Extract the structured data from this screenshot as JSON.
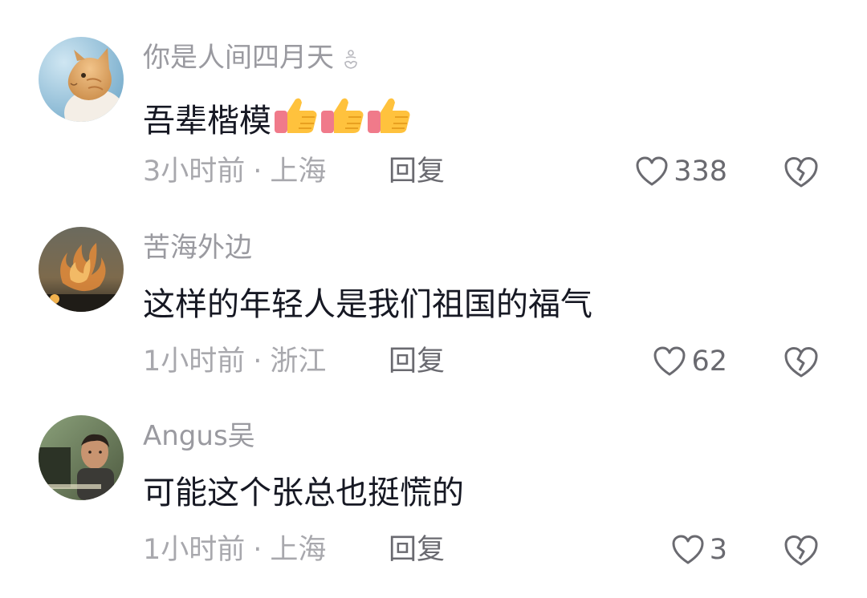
{
  "comments": [
    {
      "username": "你是人间四月天",
      "text": "吾辈楷模",
      "emoji_count": 3,
      "emoji_name": "thumbs-up-icon",
      "time": "3小时前",
      "location": "上海",
      "reply_label": "回复",
      "likes": "338",
      "avatar": "cat-avatar"
    },
    {
      "username": "苦海外边",
      "text": "这样的年轻人是我们祖国的福气",
      "time": "1小时前",
      "location": "浙江",
      "reply_label": "回复",
      "likes": "62",
      "avatar": "flame-avatar"
    },
    {
      "username": "Angus吴",
      "text": "可能这个张总也挺慌的",
      "time": "1小时前",
      "location": "上海",
      "reply_label": "回复",
      "likes": "3",
      "avatar": "man-avatar"
    }
  ],
  "separator": "·",
  "colors": {
    "username": "#9a9aa0",
    "text": "#161823",
    "meta": "#a8a8ad",
    "action": "#6a6a70"
  }
}
